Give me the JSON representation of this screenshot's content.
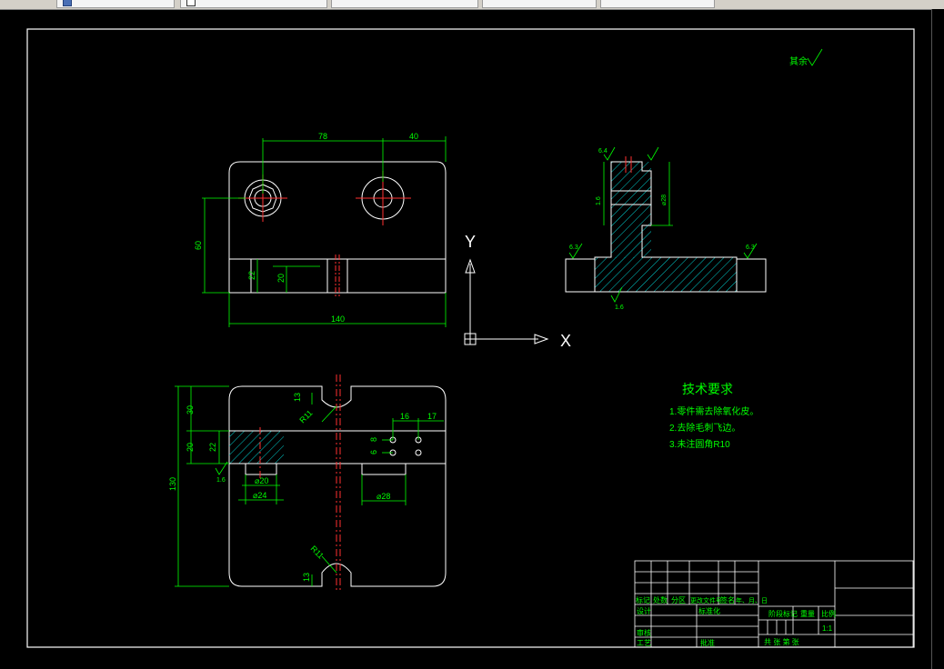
{
  "tabs": [
    "",
    "",
    "",
    "",
    ""
  ],
  "dimensions": {
    "d78": "78",
    "d40": "40",
    "d60": "60",
    "d22a": "22",
    "d20a": "20",
    "d140": "140",
    "d30": "30",
    "d20b": "20",
    "d22b": "22",
    "d130": "130",
    "d13a": "13",
    "d13b": "13",
    "dR11a": "R11",
    "dR11b": "R11",
    "dphi20": "⌀20",
    "dphi24": "⌀24",
    "dphi28": "⌀28",
    "d16": "16",
    "d17": "17",
    "d8": "8",
    "d6": "6",
    "d16r": "1.6",
    "s_top": "6.4",
    "s_left": "6.3",
    "s_right": "6.3",
    "s_bottom": "1.6",
    "s_ra": "1.6",
    "s_rb": "⌀28"
  },
  "ucs": {
    "x_label": "X",
    "y_label": "Y"
  },
  "surface_note": "其余",
  "tech": {
    "title": "技术要求",
    "items": [
      "1.零件需去除氧化皮。",
      "2.去除毛刺飞边。",
      "3.未注圆角R10"
    ]
  },
  "title_block": {
    "row_labels": [
      "标记",
      "处数",
      "分区",
      "更改文件号",
      "签名",
      "年、月、日"
    ],
    "design": "设计",
    "standardize": "标准化",
    "stage_mark": "阶段标记",
    "weight": "重量",
    "scale_label": "比例",
    "scale": "1:1",
    "review": "审核",
    "process": "工艺",
    "approve": "批准",
    "sheets": "共  张  第  张"
  }
}
